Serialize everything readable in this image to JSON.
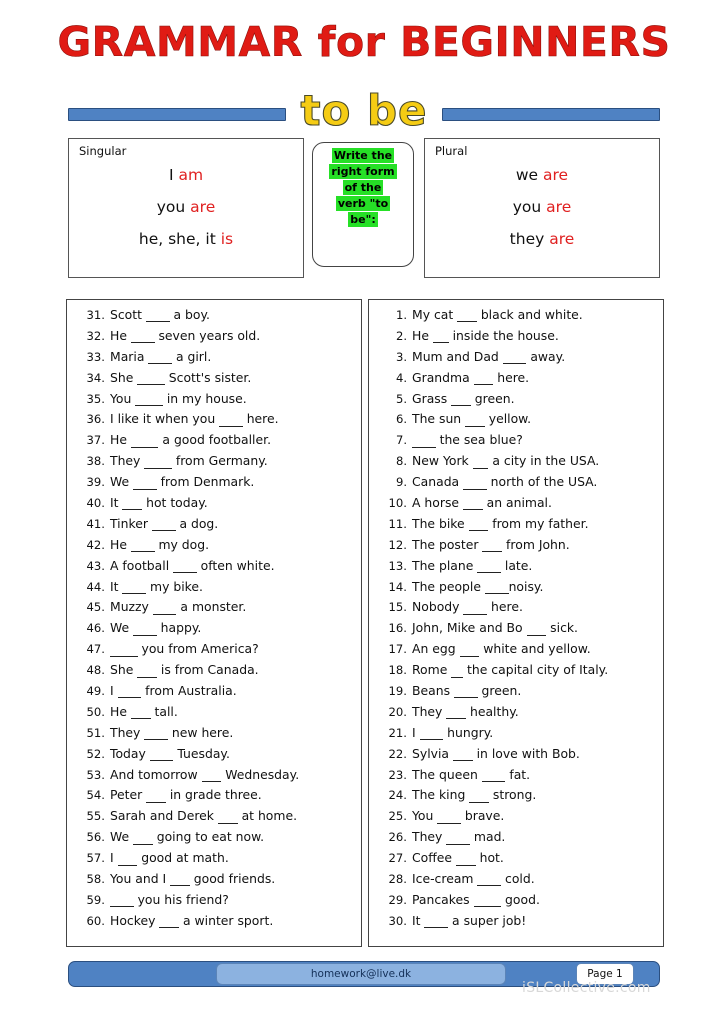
{
  "title": {
    "main": "GRAMMAR for BEGINNERS",
    "subtitle": "to be",
    "main_color": "#e01b14",
    "subtitle_color": "#f5cc14",
    "rule_color": "#4f82c3"
  },
  "singular": {
    "label": "Singular",
    "lines": [
      {
        "pronoun": "I",
        "verb": "am"
      },
      {
        "pronoun": "you",
        "verb": "are"
      },
      {
        "pronoun": "he, she, it",
        "verb": "is"
      }
    ]
  },
  "plural": {
    "label": "Plural",
    "lines": [
      {
        "pronoun": "we",
        "verb": "are"
      },
      {
        "pronoun": "you",
        "verb": "are"
      },
      {
        "pronoun": "they",
        "verb": "are"
      }
    ]
  },
  "instruction": {
    "highlight_color": "#26e026",
    "lines": [
      "Write the",
      "right form",
      "of the",
      "verb \"to",
      "be\":"
    ]
  },
  "exercises": {
    "left_column": [
      {
        "num": "31.",
        "before": "Scott ",
        "blank": "______",
        "after": " a boy."
      },
      {
        "num": "32.",
        "before": "He ",
        "blank": "______",
        "after": " seven years old."
      },
      {
        "num": "33.",
        "before": "Maria ",
        "blank": "______",
        "after": " a girl."
      },
      {
        "num": "34.",
        "before": "She ",
        "blank": "_______",
        "after": " Scott's sister."
      },
      {
        "num": "35.",
        "before": "You ",
        "blank": "_______",
        "after": " in my house."
      },
      {
        "num": "36.",
        "before": "I like it when you ",
        "blank": "______",
        "after": " here."
      },
      {
        "num": "37.",
        "before": "He ",
        "blank": "_______",
        "after": " a good footballer."
      },
      {
        "num": "38.",
        "before": "They ",
        "blank": "_______",
        "after": " from Germany."
      },
      {
        "num": "39.",
        "before": "We ",
        "blank": "______",
        "after": " from Denmark."
      },
      {
        "num": "40.",
        "before": "It ",
        "blank": "_____",
        "after": " hot today."
      },
      {
        "num": "41.",
        "before": "Tinker ",
        "blank": "______",
        "after": " a dog."
      },
      {
        "num": "42.",
        "before": "He ",
        "blank": "______",
        "after": " my dog."
      },
      {
        "num": "43.",
        "before": "A football ",
        "blank": "______",
        "after": " often white."
      },
      {
        "num": "44.",
        "before": "It ",
        "blank": "______",
        "after": " my bike."
      },
      {
        "num": "45.",
        "before": "Muzzy ",
        "blank": "______",
        "after": " a monster."
      },
      {
        "num": "46.",
        "before": "We ",
        "blank": "______",
        "after": " happy."
      },
      {
        "num": "47.",
        "before": "",
        "blank": "_______",
        "after": " you from America?"
      },
      {
        "num": "48.",
        "before": "She ",
        "blank": "_____",
        "after": " is from Canada."
      },
      {
        "num": "49.",
        "before": "I ",
        "blank": "______",
        "after": " from Australia."
      },
      {
        "num": "50.",
        "before": "He ",
        "blank": "_____",
        "after": " tall."
      },
      {
        "num": "51.",
        "before": "They ",
        "blank": "______",
        "after": " new here."
      },
      {
        "num": "52.",
        "before": "Today ",
        "blank": "______",
        "after": " Tuesday."
      },
      {
        "num": "53.",
        "before": "And tomorrow ",
        "blank": "_____",
        "after": " Wednesday."
      },
      {
        "num": "54.",
        "before": "Peter ",
        "blank": "_____",
        "after": " in grade three."
      },
      {
        "num": "55.",
        "before": "Sarah and Derek ",
        "blank": "_____",
        "after": " at home."
      },
      {
        "num": "56.",
        "before": "We ",
        "blank": "_____",
        "after": " going to eat now."
      },
      {
        "num": "57.",
        "before": "I ",
        "blank": "_____",
        "after": " good at math."
      },
      {
        "num": "58.",
        "before": "You and I ",
        "blank": "_____",
        "after": " good friends."
      },
      {
        "num": "59.",
        "before": "",
        "blank": "______",
        "after": " you his friend?"
      },
      {
        "num": "60.",
        "before": "Hockey ",
        "blank": "_____",
        "after": " a winter sport."
      }
    ],
    "right_column": [
      {
        "num": "1.",
        "before": "My cat ",
        "blank": "_____",
        "after": " black and white."
      },
      {
        "num": "2.",
        "before": "He ",
        "blank": "____",
        "after": " inside the house."
      },
      {
        "num": "3.",
        "before": "Mum and Dad ",
        "blank": "______",
        "after": " away."
      },
      {
        "num": "4.",
        "before": "Grandma ",
        "blank": "_____",
        "after": " here."
      },
      {
        "num": "5.",
        "before": "Grass ",
        "blank": "_____",
        "after": " green."
      },
      {
        "num": "6.",
        "before": "The sun ",
        "blank": "_____",
        "after": " yellow."
      },
      {
        "num": "7.",
        "before": "",
        "blank": "______",
        "after": " the sea blue?"
      },
      {
        "num": "8.",
        "before": "New York ",
        "blank": "____",
        "after": " a city in the USA."
      },
      {
        "num": "9.",
        "before": "Canada ",
        "blank": "______",
        "after": " north of the USA."
      },
      {
        "num": "10.",
        "before": "A horse ",
        "blank": "_____",
        "after": " an animal."
      },
      {
        "num": "11.",
        "before": "The bike ",
        "blank": "_____",
        "after": " from my father."
      },
      {
        "num": "12.",
        "before": "The poster ",
        "blank": "_____",
        "after": " from John."
      },
      {
        "num": "13.",
        "before": "The plane ",
        "blank": "______",
        "after": " late."
      },
      {
        "num": "14.",
        "before": "The people ",
        "blank": "______",
        "after": "noisy."
      },
      {
        "num": "15.",
        "before": "Nobody ",
        "blank": "______",
        "after": " here."
      },
      {
        "num": "16.",
        "before": "John, Mike and Bo ",
        "blank": "_____",
        "after": " sick."
      },
      {
        "num": "17.",
        "before": "An egg ",
        "blank": "_____",
        "after": " white and yellow."
      },
      {
        "num": "18.",
        "before": "Rome ",
        "blank": "___",
        "after": " the capital city of Italy."
      },
      {
        "num": "19.",
        "before": "Beans ",
        "blank": "______",
        "after": " green."
      },
      {
        "num": "20.",
        "before": "They ",
        "blank": "_____",
        "after": " healthy."
      },
      {
        "num": "21.",
        "before": "I ",
        "blank": "______",
        "after": " hungry."
      },
      {
        "num": "22.",
        "before": "Sylvia ",
        "blank": "_____",
        "after": " in love with Bob."
      },
      {
        "num": "23.",
        "before": "The queen ",
        "blank": "______",
        "after": " fat."
      },
      {
        "num": "24.",
        "before": "The king ",
        "blank": "_____",
        "after": " strong."
      },
      {
        "num": "25.",
        "before": "You ",
        "blank": "______",
        "after": " brave."
      },
      {
        "num": "26.",
        "before": "They ",
        "blank": "______",
        "after": " mad."
      },
      {
        "num": "27.",
        "before": "Coffee ",
        "blank": "_____",
        "after": " hot."
      },
      {
        "num": "28.",
        "before": "Ice-cream ",
        "blank": "______",
        "after": " cold."
      },
      {
        "num": "29.",
        "before": "Pancakes ",
        "blank": "_______",
        "after": " good."
      },
      {
        "num": "30.",
        "before": "It ",
        "blank": "______",
        "after": " a super job!"
      }
    ]
  },
  "footer": {
    "email": "homework@live.dk",
    "page": "Page 1",
    "watermark": "iSLCollective.com"
  }
}
